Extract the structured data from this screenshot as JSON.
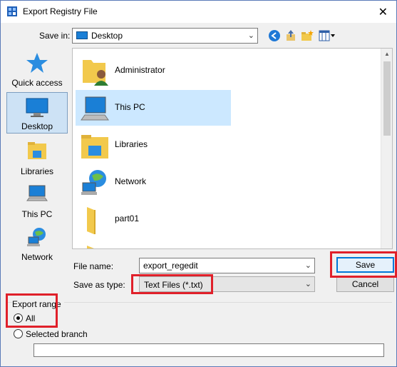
{
  "window": {
    "title": "Export Registry File",
    "close_glyph": "✕"
  },
  "savein": {
    "label": "Save in:",
    "value": "Desktop"
  },
  "toolbar": {
    "icons": [
      "back-arrow-icon",
      "up-folder-icon",
      "new-folder-icon",
      "view-menu-icon"
    ]
  },
  "places": [
    {
      "label": "Quick access",
      "icon": "star-icon"
    },
    {
      "label": "Desktop",
      "icon": "desktop-icon",
      "selected": true
    },
    {
      "label": "Libraries",
      "icon": "libraries-icon"
    },
    {
      "label": "This PC",
      "icon": "computer-icon"
    },
    {
      "label": "Network",
      "icon": "network-icon"
    }
  ],
  "files": [
    {
      "name": "Administrator",
      "icon": "user-folder-icon"
    },
    {
      "name": "This PC",
      "icon": "computer-icon",
      "selected": true
    },
    {
      "name": "Libraries",
      "icon": "libraries-icon"
    },
    {
      "name": "Network",
      "icon": "network-icon"
    },
    {
      "name": "part01",
      "icon": "folder-icon"
    }
  ],
  "form": {
    "filename_label": "File name:",
    "filename_value": "export_regedit",
    "filetype_label": "Save as type:",
    "filetype_value": "Text Files (*.txt)",
    "save_label": "Save",
    "cancel_label": "Cancel"
  },
  "range": {
    "title": "Export range",
    "all_label": "All",
    "branch_label": "Selected branch",
    "branch_value": "",
    "selected": "all"
  },
  "colors": {
    "highlight": "#e0202a",
    "selection": "#cce8ff",
    "accent": "#0078d7"
  }
}
